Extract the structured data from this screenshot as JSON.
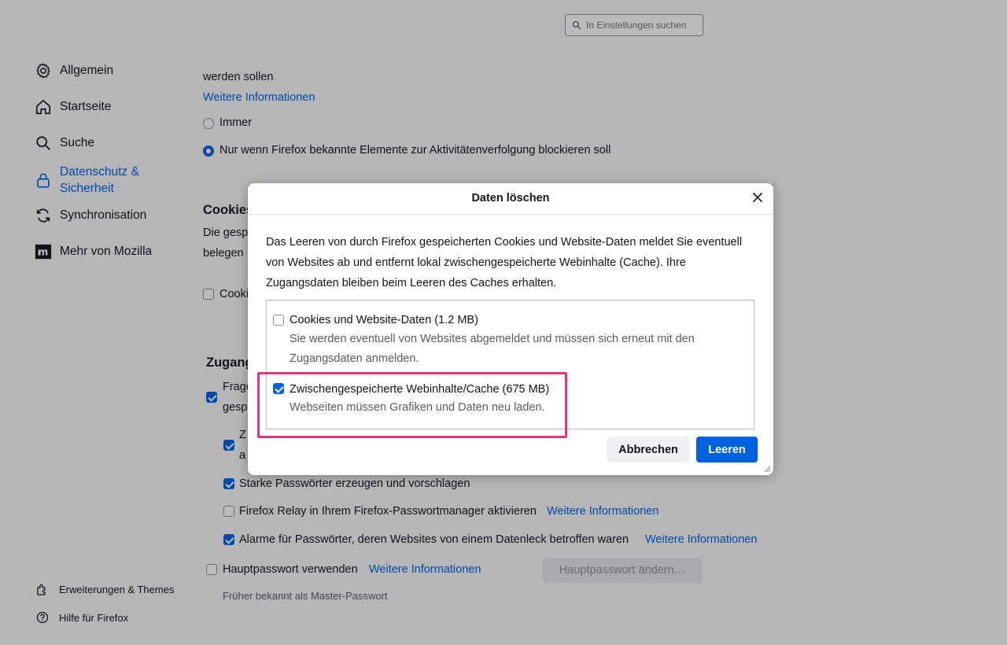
{
  "search": {
    "placeholder": "In Einstellungen suchen"
  },
  "sidebar": {
    "items": [
      {
        "label": "Allgemein",
        "icon": "gear-icon"
      },
      {
        "label": "Startseite",
        "icon": "home-icon"
      },
      {
        "label": "Suche",
        "icon": "search-icon"
      },
      {
        "label": "Datenschutz & Sicherheit",
        "label_line1": "Datenschutz &",
        "label_line2": "Sicherheit",
        "icon": "lock-icon",
        "active": true
      },
      {
        "label": "Synchronisation",
        "icon": "sync-icon"
      },
      {
        "label": "Mehr von Mozilla",
        "icon": "mozilla-icon"
      }
    ],
    "footer": [
      {
        "label": "Erweiterungen & Themes",
        "icon": "puzzle-icon"
      },
      {
        "label": "Hilfe für Firefox",
        "icon": "help-icon"
      }
    ]
  },
  "content": {
    "dnt_tail": "werden sollen",
    "dnt_link": "Weitere Informationen",
    "dnt_opt_always": "Immer",
    "dnt_opt_known": "Nur wenn Firefox bekannte Elemente zur Aktivitätenverfolgung blockieren soll",
    "cookies_heading": "Cookies",
    "cookies_text_1": "Die gesp",
    "cookies_text_2": "belegen",
    "cookies_checkbox": "Cooki",
    "logins_heading": "Zugang",
    "logins_ask_1": "Frage",
    "logins_ask_2": "gesp",
    "logins_sub_1": "Z",
    "logins_sub_2": "a",
    "strong_pw": "Starke Passwörter erzeugen und vorschlagen",
    "relay": "Firefox Relay in Ihrem Firefox-Passwortmanager aktivieren",
    "relay_link": "Weitere Informationen",
    "breach": "Alarme für Passwörter, deren Websites von einem Datenleck betroffen waren",
    "breach_link": "Weitere Informationen",
    "primary_pw": "Hauptpasswort verwenden",
    "primary_pw_link": "Weitere Informationen",
    "primary_pw_button": "Hauptpasswort ändern…",
    "primary_pw_note": "Früher bekannt als Master-Passwort"
  },
  "dialog": {
    "title": "Daten löschen",
    "description": "Das Leeren von durch Firefox gespeicherten Cookies und Website-Daten meldet Sie eventuell von Websites ab und entfernt lokal zwischengespeicherte Webinhalte (Cache). Ihre Zugangsdaten bleiben beim Leeren des Caches erhalten.",
    "desc_line1": "Das Leeren von durch Firefox gespeicherten Cookies und Website-Daten meldet Sie eventuell",
    "desc_line2": "von Websites ab und entfernt lokal zwischengespeicherte Webinhalte (Cache). Ihre",
    "desc_line3": "Zugangsdaten bleiben beim Leeren des Caches erhalten.",
    "items": [
      {
        "label": "Cookies und Website-Daten (1.2 MB)",
        "desc_line1": "Sie werden eventuell von Websites abgemeldet und müssen sich erneut mit den",
        "desc_line2": "Zugangsdaten anmelden.",
        "checked": false
      },
      {
        "label": "Zwischengespeicherte Webinhalte/Cache (675 MB)",
        "desc_line1": "Webseiten müssen Grafiken und Daten neu laden.",
        "checked": true
      }
    ],
    "cancel": "Abbrechen",
    "confirm": "Leeren"
  },
  "colors": {
    "accent": "#0061e0",
    "highlight": "#e5347a"
  }
}
